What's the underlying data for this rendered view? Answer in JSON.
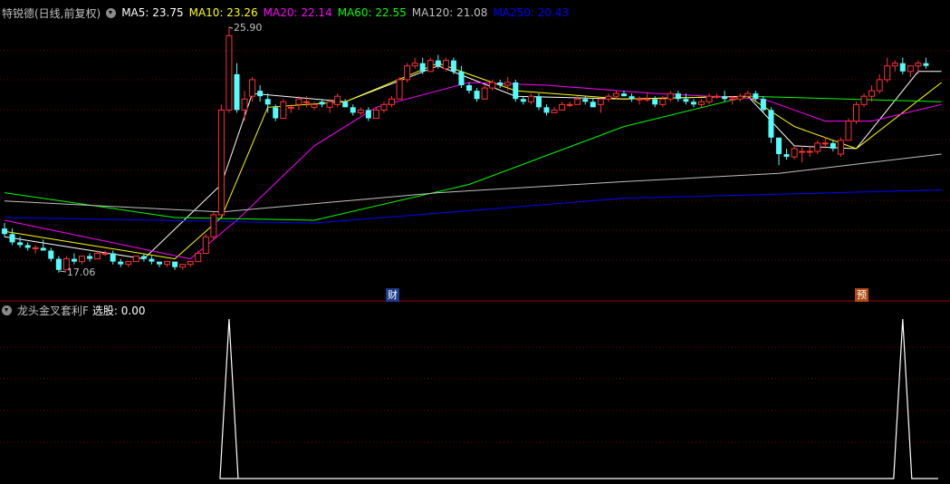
{
  "header": {
    "title": "特锐德(日线,前复权)",
    "ma_labels": [
      {
        "text": "MA5: 23.75",
        "color": "#ffffff"
      },
      {
        "text": "MA10: 23.26",
        "color": "#ffff00"
      },
      {
        "text": "MA20: 22.14",
        "color": "#ff00ff"
      },
      {
        "text": "MA60: 22.55",
        "color": "#00ff00"
      },
      {
        "text": "MA120: 21.08",
        "color": "#c0c0c0"
      },
      {
        "text": "MA250: 20.43",
        "color": "#0000ff"
      }
    ]
  },
  "indicator": {
    "title": "龙头金叉套利F",
    "value_text": "选股: 0.00"
  },
  "annotations": {
    "high_label": "25.90",
    "low_label": "17.06",
    "event_cai": "财",
    "event_yu": "预"
  },
  "colors": {
    "up": "#ff3232",
    "down": "#54fcfc",
    "grid": "#7a0000",
    "ma5": "#ffffff",
    "ma10": "#ffff00",
    "ma20": "#ff00ff",
    "ma60": "#00ff00",
    "ma120": "#c0c0c0",
    "ma250": "#0000ff"
  },
  "chart_data": {
    "type": "candlestick",
    "price_range": [
      16.5,
      26.3
    ],
    "candles": [
      [
        18.6,
        18.8,
        18.3,
        18.4
      ],
      [
        18.4,
        18.6,
        18.0,
        18.1
      ],
      [
        18.1,
        18.3,
        17.9,
        18.0
      ],
      [
        18.0,
        18.1,
        17.8,
        17.9
      ],
      [
        17.9,
        18.0,
        17.7,
        17.9
      ],
      [
        17.9,
        18.2,
        17.8,
        17.8
      ],
      [
        17.8,
        17.9,
        17.4,
        17.5
      ],
      [
        17.5,
        17.6,
        17.0,
        17.1
      ],
      [
        17.1,
        17.6,
        17.1,
        17.5
      ],
      [
        17.5,
        17.7,
        17.3,
        17.4
      ],
      [
        17.4,
        17.6,
        17.3,
        17.6
      ],
      [
        17.6,
        17.7,
        17.4,
        17.5
      ],
      [
        17.5,
        17.8,
        17.5,
        17.7
      ],
      [
        17.7,
        17.8,
        17.6,
        17.7
      ],
      [
        17.7,
        17.8,
        17.3,
        17.4
      ],
      [
        17.4,
        17.5,
        17.2,
        17.3
      ],
      [
        17.3,
        17.4,
        17.2,
        17.4
      ],
      [
        17.4,
        17.6,
        17.4,
        17.6
      ],
      [
        17.6,
        17.7,
        17.4,
        17.5
      ],
      [
        17.5,
        17.6,
        17.3,
        17.4
      ],
      [
        17.4,
        17.4,
        17.2,
        17.3
      ],
      [
        17.3,
        17.4,
        17.2,
        17.4
      ],
      [
        17.4,
        17.4,
        17.1,
        17.2
      ],
      [
        17.2,
        17.3,
        17.1,
        17.3
      ],
      [
        17.3,
        17.4,
        17.2,
        17.4
      ],
      [
        17.4,
        17.8,
        17.4,
        17.7
      ],
      [
        17.7,
        18.4,
        17.7,
        18.3
      ],
      [
        18.3,
        19.2,
        18.2,
        19.1
      ],
      [
        19.1,
        23.1,
        19.1,
        22.9
      ],
      [
        22.9,
        25.9,
        22.8,
        25.6
      ],
      [
        24.2,
        24.6,
        22.8,
        22.9
      ],
      [
        22.9,
        23.6,
        22.5,
        23.3
      ],
      [
        23.4,
        24.1,
        23.2,
        24.0
      ],
      [
        23.6,
        23.8,
        23.2,
        23.4
      ],
      [
        23.3,
        23.5,
        22.8,
        23.1
      ],
      [
        23.0,
        23.1,
        22.5,
        22.6
      ],
      [
        22.6,
        23.3,
        22.6,
        23.2
      ],
      [
        23.0,
        23.1,
        22.8,
        23.0
      ],
      [
        23.1,
        23.4,
        22.9,
        23.3
      ],
      [
        23.2,
        23.4,
        23.0,
        23.2
      ],
      [
        23.0,
        23.2,
        22.9,
        23.1
      ],
      [
        23.2,
        23.3,
        23.0,
        23.1
      ],
      [
        23.0,
        23.3,
        22.8,
        23.2
      ],
      [
        23.1,
        23.5,
        23.0,
        23.4
      ],
      [
        23.2,
        23.3,
        23.0,
        23.0
      ],
      [
        23.0,
        23.1,
        22.7,
        22.8
      ],
      [
        22.8,
        23.0,
        22.7,
        22.9
      ],
      [
        22.9,
        23.0,
        22.5,
        22.6
      ],
      [
        22.6,
        23.0,
        22.6,
        22.9
      ],
      [
        22.9,
        23.2,
        22.8,
        23.1
      ],
      [
        23.1,
        23.4,
        23.0,
        23.3
      ],
      [
        23.3,
        24.1,
        23.3,
        24.0
      ],
      [
        24.0,
        24.6,
        23.9,
        24.5
      ],
      [
        24.5,
        24.8,
        24.4,
        24.6
      ],
      [
        24.6,
        24.8,
        24.2,
        24.3
      ],
      [
        24.3,
        24.8,
        24.3,
        24.7
      ],
      [
        24.7,
        24.9,
        24.4,
        24.5
      ],
      [
        24.4,
        24.8,
        24.3,
        24.7
      ],
      [
        24.7,
        24.8,
        24.2,
        24.3
      ],
      [
        24.3,
        24.5,
        23.7,
        23.8
      ],
      [
        23.8,
        23.9,
        23.5,
        23.6
      ],
      [
        23.6,
        23.7,
        23.2,
        23.3
      ],
      [
        23.3,
        23.8,
        23.3,
        23.7
      ],
      [
        23.7,
        24.0,
        23.6,
        23.9
      ],
      [
        23.9,
        24.0,
        23.7,
        23.8
      ],
      [
        23.8,
        24.1,
        23.6,
        23.9
      ],
      [
        23.9,
        24.0,
        23.2,
        23.3
      ],
      [
        23.3,
        23.4,
        23.1,
        23.2
      ],
      [
        23.2,
        23.5,
        23.1,
        23.4
      ],
      [
        23.4,
        23.5,
        22.9,
        23.0
      ],
      [
        23.0,
        23.1,
        22.7,
        22.8
      ],
      [
        22.8,
        23.0,
        22.8,
        22.9
      ],
      [
        22.9,
        23.2,
        22.9,
        23.1
      ],
      [
        23.1,
        23.2,
        23.0,
        23.1
      ],
      [
        23.1,
        23.4,
        23.1,
        23.3
      ],
      [
        23.3,
        23.4,
        23.1,
        23.2
      ],
      [
        23.2,
        23.3,
        23.0,
        23.0
      ],
      [
        23.1,
        23.3,
        22.8,
        23.3
      ],
      [
        23.3,
        23.5,
        23.2,
        23.4
      ],
      [
        23.4,
        23.6,
        23.3,
        23.5
      ],
      [
        23.5,
        23.6,
        23.4,
        23.4
      ],
      [
        23.4,
        23.5,
        23.2,
        23.3
      ],
      [
        23.3,
        23.4,
        23.1,
        23.3
      ],
      [
        23.3,
        23.5,
        23.2,
        23.3
      ],
      [
        23.3,
        23.4,
        23.0,
        23.1
      ],
      [
        23.1,
        23.4,
        23.0,
        23.3
      ],
      [
        23.3,
        23.6,
        23.2,
        23.5
      ],
      [
        23.5,
        23.6,
        23.2,
        23.3
      ],
      [
        23.3,
        23.5,
        23.1,
        23.2
      ],
      [
        23.2,
        23.3,
        23.0,
        23.1
      ],
      [
        23.1,
        23.3,
        23.0,
        23.2
      ],
      [
        23.2,
        23.5,
        23.1,
        23.4
      ],
      [
        23.4,
        23.5,
        23.3,
        23.4
      ],
      [
        23.4,
        23.6,
        23.2,
        23.3
      ],
      [
        23.3,
        23.4,
        23.1,
        23.3
      ],
      [
        23.3,
        23.5,
        23.2,
        23.4
      ],
      [
        23.4,
        23.6,
        23.3,
        23.5
      ],
      [
        23.5,
        23.6,
        23.2,
        23.3
      ],
      [
        23.3,
        23.4,
        22.8,
        22.9
      ],
      [
        22.9,
        23.0,
        21.7,
        21.9
      ],
      [
        21.9,
        21.9,
        20.9,
        21.3
      ],
      [
        21.3,
        21.5,
        21.1,
        21.2
      ],
      [
        21.2,
        21.6,
        21.1,
        21.5
      ],
      [
        21.4,
        21.6,
        21.0,
        21.4
      ],
      [
        21.4,
        21.6,
        21.2,
        21.4
      ],
      [
        21.4,
        21.8,
        21.3,
        21.7
      ],
      [
        21.7,
        21.9,
        21.5,
        21.7
      ],
      [
        21.7,
        21.8,
        21.4,
        21.5
      ],
      [
        21.3,
        21.9,
        21.2,
        21.8
      ],
      [
        21.8,
        22.6,
        21.8,
        22.5
      ],
      [
        22.5,
        23.2,
        22.4,
        23.1
      ],
      [
        23.1,
        23.5,
        23.0,
        23.4
      ],
      [
        23.4,
        23.8,
        23.2,
        23.6
      ],
      [
        23.6,
        24.2,
        23.5,
        24.0
      ],
      [
        24.0,
        24.8,
        23.9,
        24.5
      ],
      [
        24.5,
        24.7,
        24.3,
        24.6
      ],
      [
        24.6,
        24.8,
        24.2,
        24.3
      ],
      [
        24.3,
        24.5,
        24.1,
        24.5
      ],
      [
        24.5,
        24.7,
        24.2,
        24.6
      ],
      [
        24.6,
        24.8,
        24.4,
        24.5
      ]
    ],
    "ma_lines": {
      "ma5": [
        [
          0,
          18.3
        ],
        [
          18,
          17.5
        ],
        [
          28,
          20.2
        ],
        [
          32,
          23.5
        ],
        [
          44,
          23.2
        ],
        [
          56,
          24.5
        ],
        [
          66,
          23.4
        ],
        [
          80,
          23.3
        ],
        [
          96,
          23.4
        ],
        [
          102,
          21.6
        ],
        [
          110,
          21.5
        ],
        [
          118,
          24.3
        ],
        [
          121,
          24.3
        ]
      ],
      "ma10": [
        [
          0,
          18.5
        ],
        [
          22,
          17.5
        ],
        [
          28,
          19.0
        ],
        [
          34,
          23.0
        ],
        [
          44,
          23.2
        ],
        [
          56,
          24.6
        ],
        [
          66,
          23.6
        ],
        [
          80,
          23.3
        ],
        [
          96,
          23.4
        ],
        [
          102,
          22.3
        ],
        [
          110,
          21.5
        ],
        [
          121,
          23.9
        ]
      ],
      "ma20": [
        [
          0,
          18.9
        ],
        [
          24,
          17.5
        ],
        [
          30,
          18.9
        ],
        [
          40,
          21.6
        ],
        [
          48,
          23.0
        ],
        [
          60,
          23.9
        ],
        [
          70,
          23.8
        ],
        [
          84,
          23.5
        ],
        [
          98,
          23.3
        ],
        [
          106,
          22.5
        ],
        [
          112,
          22.5
        ],
        [
          121,
          23.1
        ]
      ],
      "ma60": [
        [
          0,
          19.9
        ],
        [
          22,
          19.0
        ],
        [
          40,
          18.9
        ],
        [
          60,
          20.2
        ],
        [
          80,
          22.3
        ],
        [
          96,
          23.4
        ],
        [
          121,
          23.2
        ]
      ],
      "ma120": [
        [
          0,
          19.6
        ],
        [
          28,
          19.2
        ],
        [
          56,
          19.9
        ],
        [
          80,
          20.3
        ],
        [
          100,
          20.6
        ],
        [
          121,
          21.3
        ]
      ],
      "ma250": [
        [
          0,
          19.0
        ],
        [
          40,
          18.8
        ],
        [
          80,
          19.7
        ],
        [
          121,
          20.0
        ]
      ]
    },
    "high_point": {
      "index": 29,
      "value": 25.9
    },
    "low_point": {
      "index": 7,
      "value": 17.06
    },
    "indicator_peaks": [
      29,
      116
    ]
  }
}
